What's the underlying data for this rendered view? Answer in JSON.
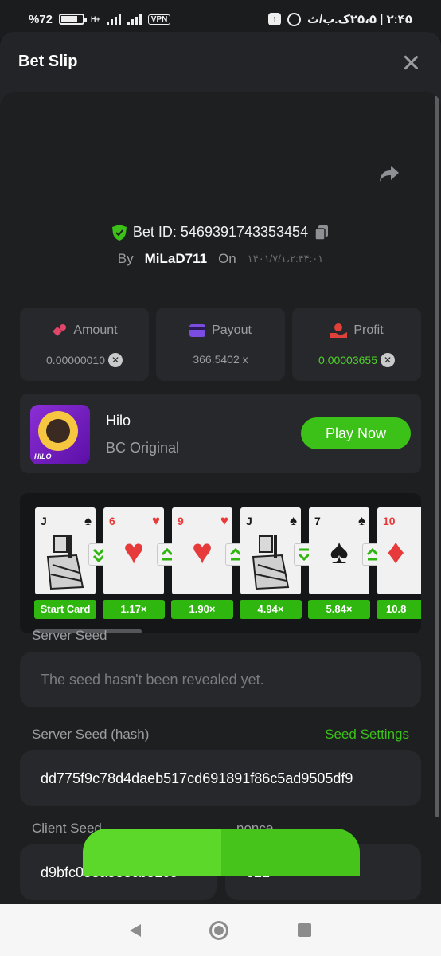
{
  "statusbar": {
    "battery": "%72",
    "network": "H+",
    "vpn": "VPN",
    "time_text": "۲:۴۵ | ۲۵،۵ک.ب/ث"
  },
  "sheet": {
    "title": "Bet Slip"
  },
  "bet": {
    "id_label": "Bet ID: 5469391743353454",
    "by_label": "By",
    "user": "MiLaD711",
    "on_label": "On",
    "date": "۱۴۰۱/۷/۱،۲:۴۴:۰۱"
  },
  "stats": [
    {
      "label": "Amount",
      "value": "0.00000010",
      "coin": true
    },
    {
      "label": "Payout",
      "value": "366.5402 x",
      "coin": false
    },
    {
      "label": "Profit",
      "value": "0.00003655",
      "coin": true
    }
  ],
  "colors": {
    "accent_green": "#3bc117",
    "profit_green": "#4fd12a",
    "amount_icon": "#e0456a",
    "payout_icon": "#7b4ce0",
    "profit_icon": "#e0403a"
  },
  "game": {
    "name": "Hilo",
    "provider": "BC Original",
    "play_label": "Play Now",
    "thumb_tag": "HILO"
  },
  "cards": [
    {
      "rank": "J",
      "suit": "♠",
      "face": "court",
      "mult": "Start Card"
    },
    {
      "rank": "6",
      "suit": "♥",
      "face": "♥",
      "mult": "1.17×",
      "arrow": "down"
    },
    {
      "rank": "9",
      "suit": "♥",
      "face": "♥",
      "mult": "1.90×",
      "arrow": "up"
    },
    {
      "rank": "J",
      "suit": "♠",
      "face": "court",
      "mult": "4.94×",
      "arrow": "up"
    },
    {
      "rank": "7",
      "suit": "♠",
      "face": "♠",
      "mult": "5.84×",
      "arrow": "down"
    },
    {
      "rank": "10",
      "suit": "♦",
      "face": "♦",
      "mult": "10.8",
      "arrow": "up"
    }
  ],
  "form": {
    "server_seed_label": "Server Seed",
    "server_seed_placeholder": "The seed hasn't been revealed yet.",
    "hash_label": "Server Seed (hash)",
    "seed_settings": "Seed Settings",
    "hash_value": "dd775f9c78d4daeb517cd691891f86c5ad9505df9",
    "client_seed_label": "Client Seed",
    "client_seed_value": "d9bfc058a583cb81ce",
    "nonce_label": "nonce",
    "nonce_value": "622"
  }
}
